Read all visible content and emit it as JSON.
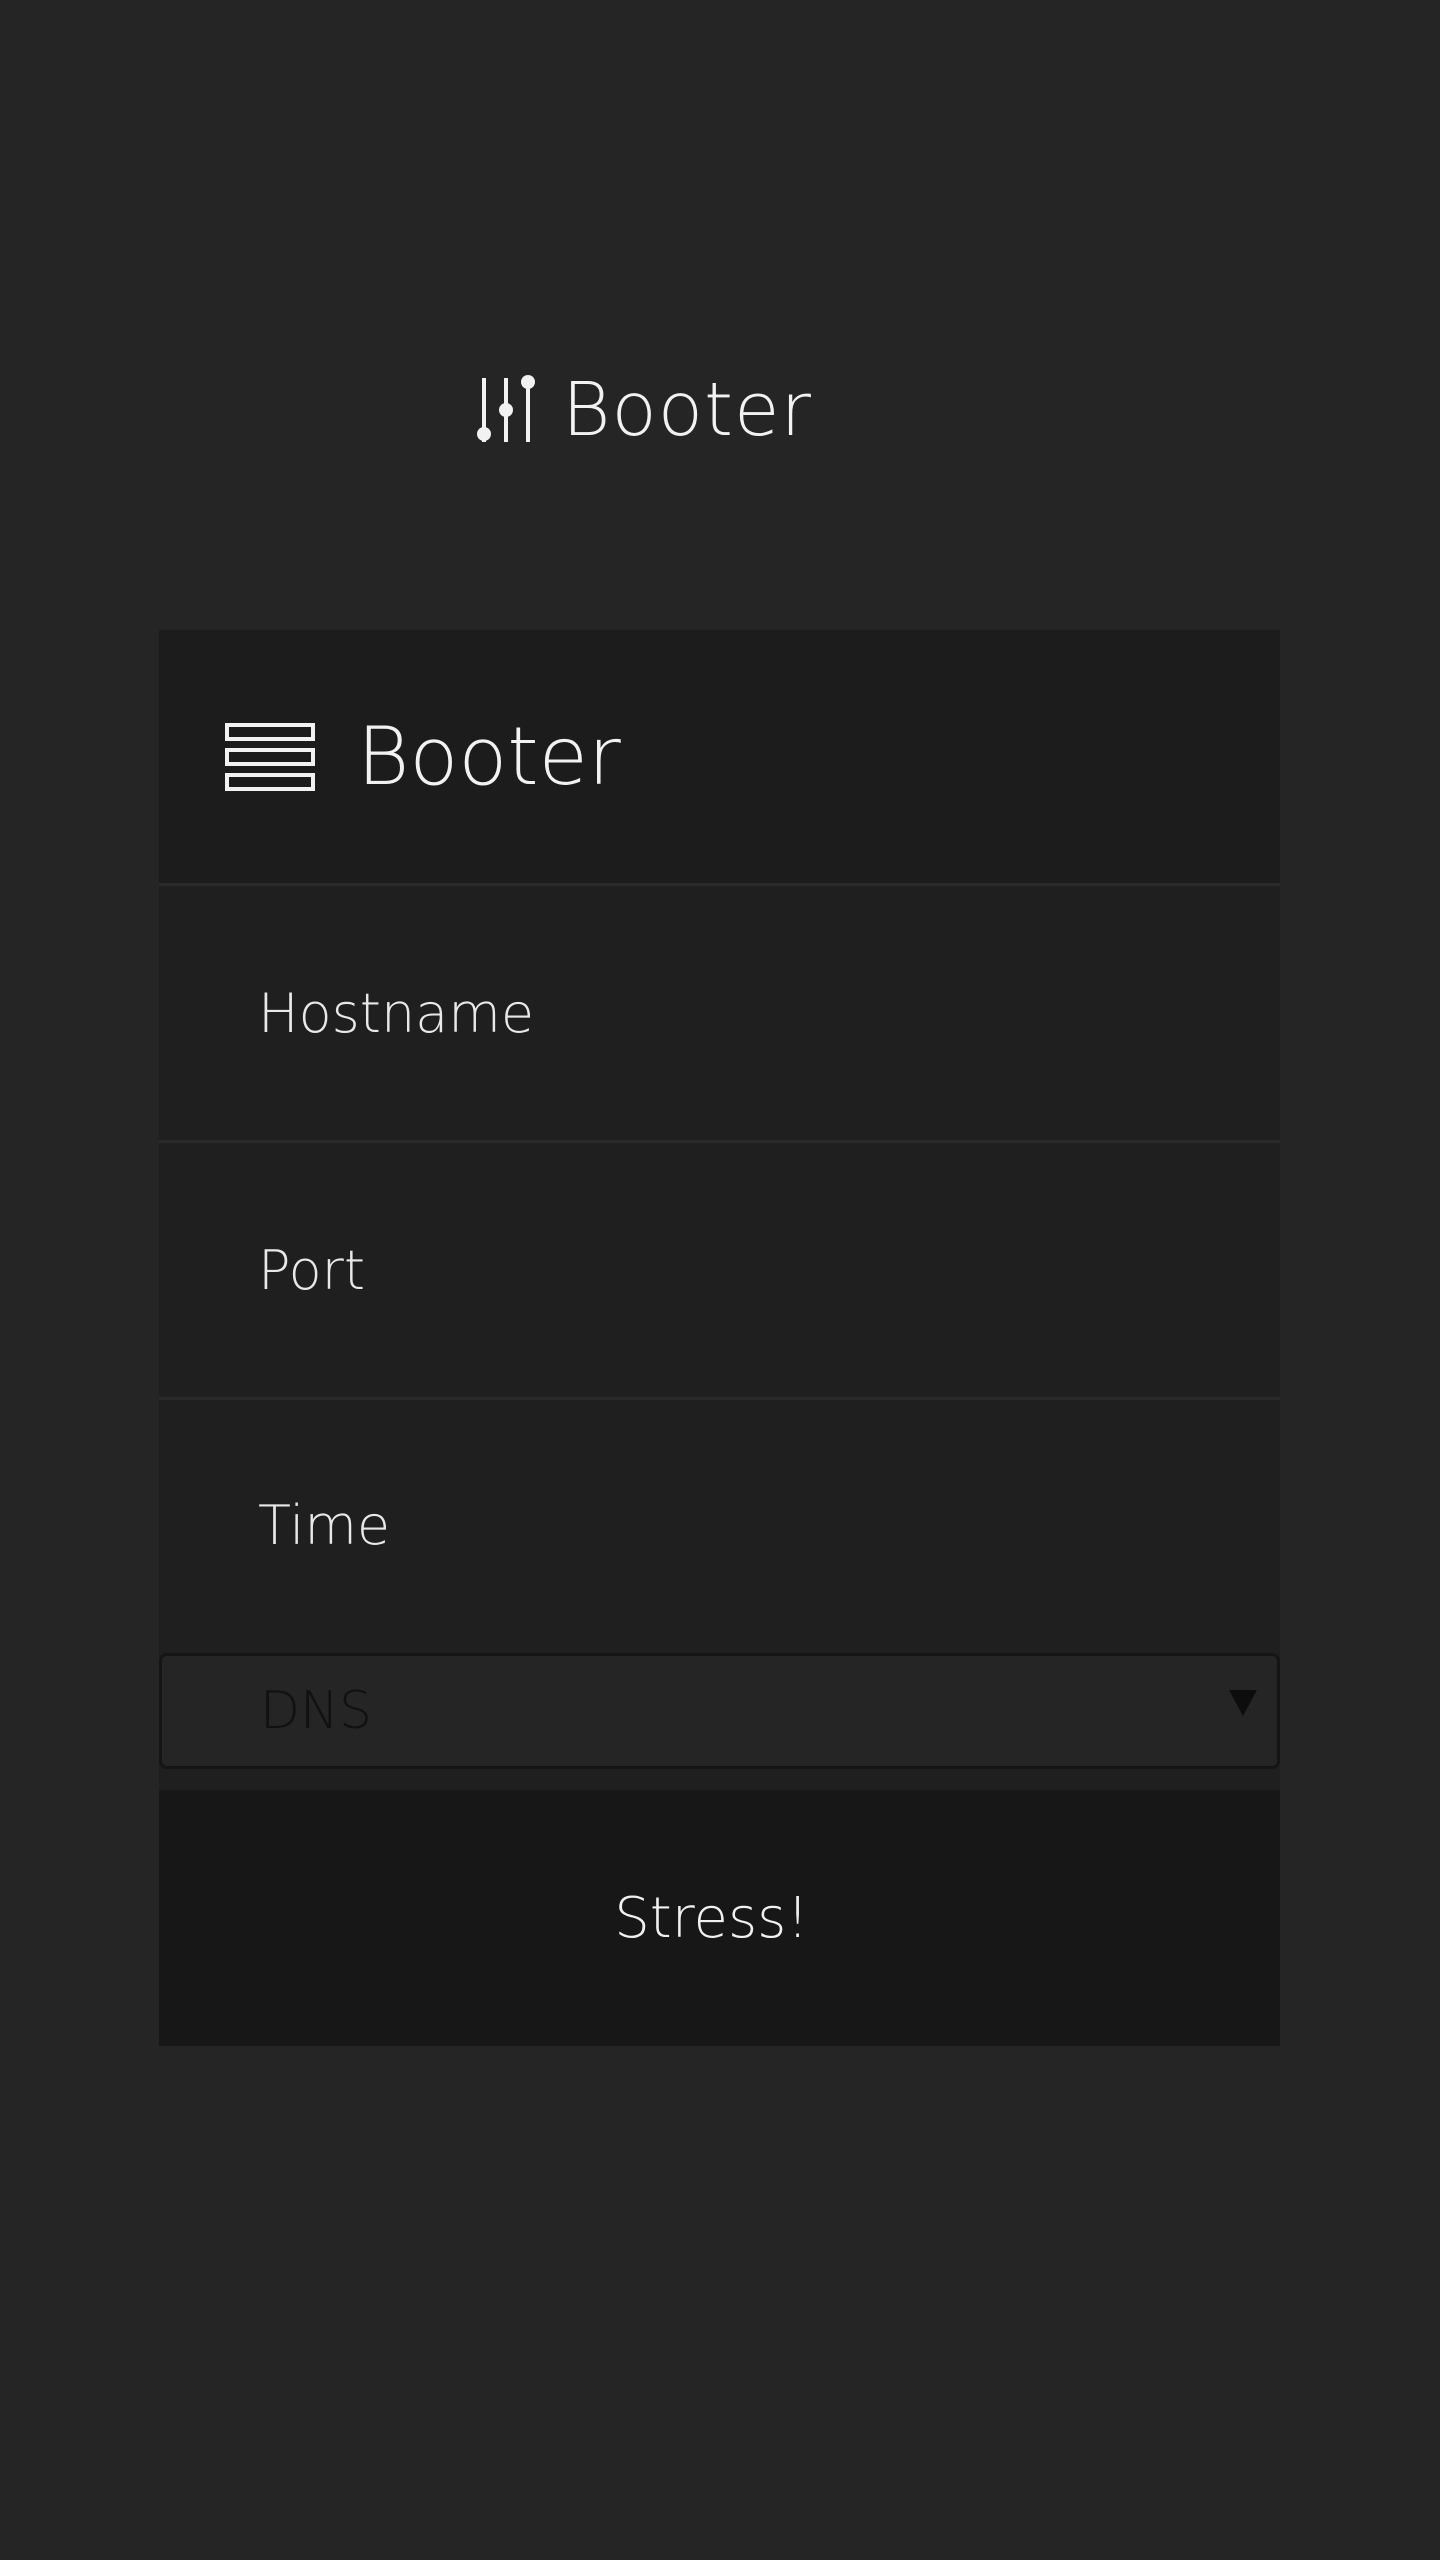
{
  "header": {
    "title": "Booter",
    "logo_icon": "sliders-icon"
  },
  "panel": {
    "title": "Booter",
    "menu_icon": "menu-icon",
    "fields": {
      "hostname": {
        "value": "",
        "placeholder": "Hostname"
      },
      "port": {
        "value": "",
        "placeholder": "Port"
      },
      "time": {
        "value": "",
        "placeholder": "Time"
      }
    },
    "method": {
      "selected": "DNS",
      "caret_icon": "caret-down-icon"
    },
    "submit_label": "Stress!"
  },
  "colors": {
    "background": "#252525",
    "panel": "#1f1f1f",
    "panel_header": "#1c1c1c",
    "button": "#171717",
    "text": "#f0f0f0"
  }
}
